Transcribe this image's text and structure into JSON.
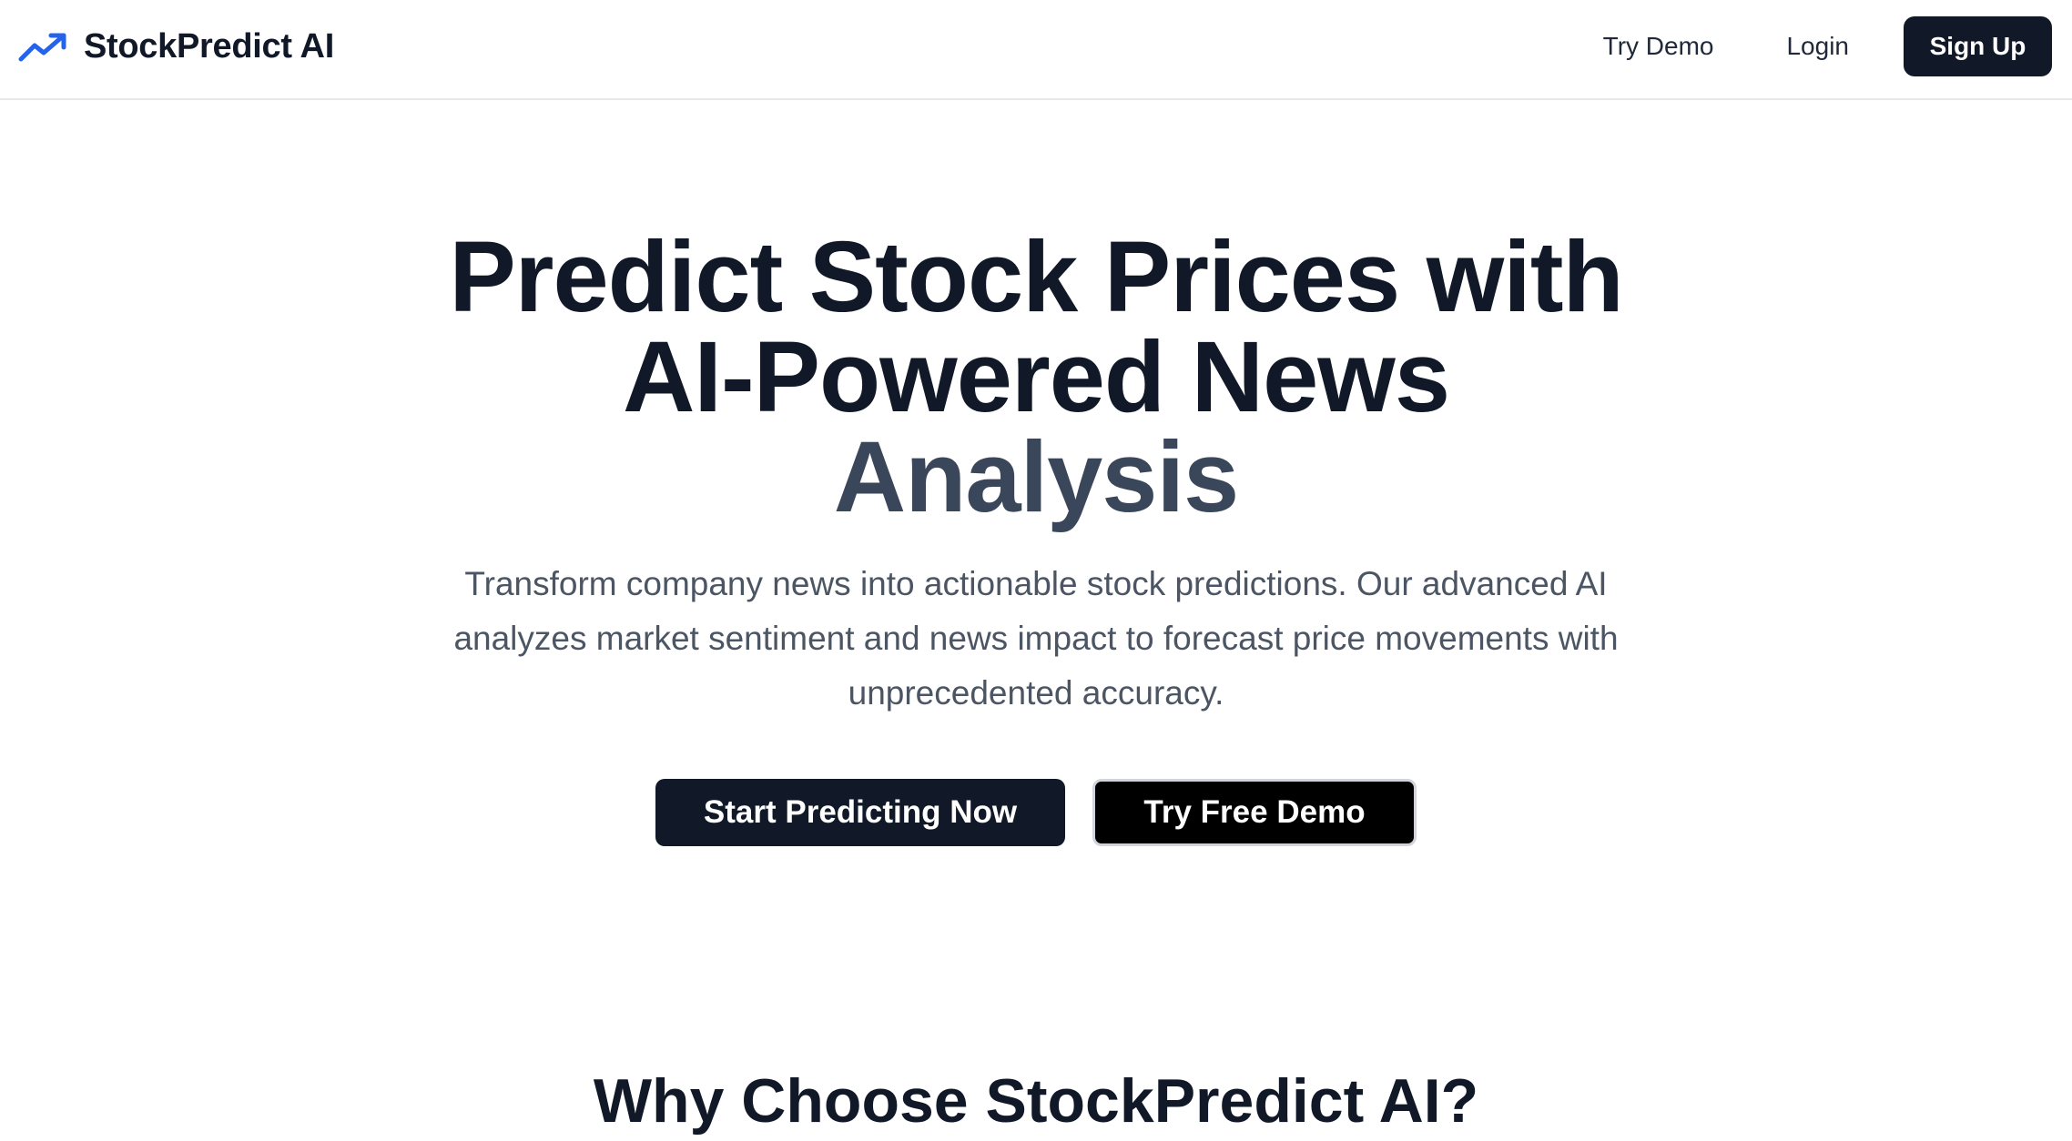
{
  "header": {
    "brand_name": "StockPredict AI",
    "brand_icon": "trending-up-icon",
    "nav": {
      "try_demo": "Try Demo",
      "login": "Login",
      "sign_up": "Sign Up"
    }
  },
  "hero": {
    "title_line1": "Predict Stock Prices with",
    "title_line2": "AI-Powered News",
    "title_line3": "Analysis",
    "subtitle": "Transform company news into actionable stock predictions. Our advanced AI analyzes market sentiment and news impact to forecast price movements with unprecedented accuracy.",
    "primary_cta": "Start Predicting Now",
    "secondary_cta": "Try Free Demo"
  },
  "features": {
    "title": "Why Choose StockPredict AI?"
  },
  "colors": {
    "accent": "#2563eb",
    "primary": "#111827",
    "muted_heading": "#3a4659",
    "body_text": "#4b5563"
  }
}
